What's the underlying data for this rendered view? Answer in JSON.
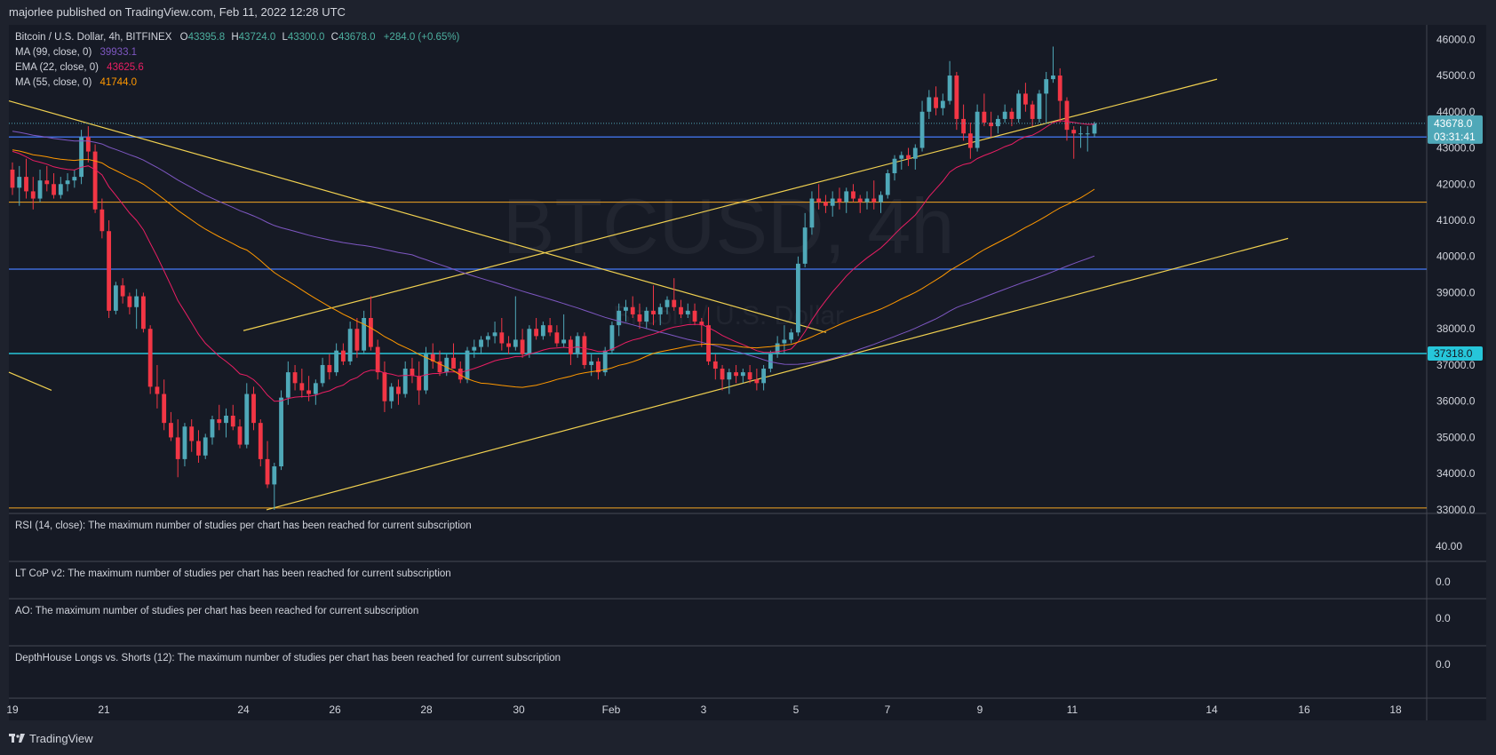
{
  "header": {
    "published": "majorlee published on TradingView.com, Feb 11, 2022 12:28 UTC"
  },
  "legend": {
    "symbol": "Bitcoin / U.S. Dollar, 4h, BITFINEX",
    "open_label": "O",
    "open": "43395.8",
    "high_label": "H",
    "high": "43724.0",
    "low_label": "L",
    "low": "43300.0",
    "close_label": "C",
    "close": "43678.0",
    "change": "+284.0 (+0.65%)",
    "indicators": [
      {
        "label": "MA (99, close, 0)",
        "value": "39933.1",
        "color": "#7e57c2"
      },
      {
        "label": "EMA (22, close, 0)",
        "value": "43625.6",
        "color": "#e91e63"
      },
      {
        "label": "MA (55, close, 0)",
        "value": "41744.0",
        "color": "#ff9800"
      }
    ]
  },
  "watermark": {
    "symbol": "BTCUSD, 4h",
    "name": "Bitcoin / U.S. Dollar"
  },
  "price_badges": {
    "last": "43678.0",
    "countdown": "03:31:41",
    "level": "37318.0"
  },
  "panes": [
    {
      "label": "RSI (14, close): The maximum number of studies per chart has been reached for current subscription",
      "value": "40.00"
    },
    {
      "label": "LT CoP v2: The maximum number of studies per chart has been reached for current subscription",
      "value": "0.0"
    },
    {
      "label": "AO: The maximum number of studies per chart has been reached for current subscription",
      "value": "0.0"
    },
    {
      "label": "DepthHouse Longs vs. Shorts (12): The maximum number of studies per chart has been reached for current subscription",
      "value": "0.0"
    }
  ],
  "footer": {
    "brand": "TradingView"
  },
  "colors": {
    "up": "#4fa8b8",
    "down": "#f23645",
    "trendline": "#f0d050",
    "support_blue": "#3d6bd6",
    "support_cyan": "#26c6da",
    "support_orange": "#f5a623"
  },
  "chart_data": {
    "type": "candlestick",
    "title": "Bitcoin / U.S. Dollar, 4h, BITFINEX",
    "x_ticks": [
      "19",
      "21",
      "24",
      "26",
      "28",
      "30",
      "Feb",
      "3",
      "5",
      "7",
      "9",
      "11",
      "14",
      "16",
      "18"
    ],
    "y_ticks": [
      33000,
      34000,
      35000,
      36000,
      37000,
      38000,
      39000,
      40000,
      41000,
      42000,
      43000,
      44000,
      45000,
      46000
    ],
    "ylim": [
      32900,
      46400
    ],
    "candles": [
      [
        42400,
        42600,
        41700,
        41900
      ],
      [
        41900,
        42500,
        41400,
        42200
      ],
      [
        42200,
        42700,
        41600,
        41800
      ],
      [
        41800,
        42200,
        41300,
        41600
      ],
      [
        41600,
        42400,
        41500,
        42100
      ],
      [
        42100,
        42500,
        41800,
        42000
      ],
      [
        42000,
        42300,
        41600,
        41700
      ],
      [
        41700,
        42200,
        41600,
        42000
      ],
      [
        42000,
        42300,
        41800,
        42100
      ],
      [
        42100,
        42400,
        41900,
        42200
      ],
      [
        42200,
        43500,
        42000,
        43300
      ],
      [
        43300,
        43600,
        42600,
        42900
      ],
      [
        42900,
        43100,
        41200,
        41300
      ],
      [
        41300,
        41600,
        40500,
        40700
      ],
      [
        40700,
        41000,
        38300,
        38500
      ],
      [
        38500,
        39300,
        38400,
        39200
      ],
      [
        39200,
        39400,
        38700,
        38900
      ],
      [
        38900,
        39000,
        38400,
        38600
      ],
      [
        38600,
        39100,
        38000,
        38900
      ],
      [
        38900,
        39000,
        37900,
        38000
      ],
      [
        38000,
        38100,
        36200,
        36400
      ],
      [
        36400,
        37000,
        35800,
        36200
      ],
      [
        36200,
        36600,
        35200,
        35400
      ],
      [
        35400,
        35700,
        34900,
        35000
      ],
      [
        35000,
        35500,
        33900,
        34400
      ],
      [
        34400,
        35400,
        34200,
        35300
      ],
      [
        35300,
        35500,
        34600,
        34900
      ],
      [
        34900,
        35200,
        34300,
        34500
      ],
      [
        34500,
        35100,
        34400,
        35000
      ],
      [
        35000,
        35600,
        34800,
        35500
      ],
      [
        35500,
        35900,
        35200,
        35400
      ],
      [
        35400,
        35800,
        35000,
        35600
      ],
      [
        35600,
        35900,
        35200,
        35300
      ],
      [
        35300,
        35500,
        34700,
        34800
      ],
      [
        34800,
        36500,
        34700,
        36200
      ],
      [
        36200,
        36400,
        35200,
        35400
      ],
      [
        35400,
        35500,
        34200,
        34400
      ],
      [
        34400,
        34900,
        33600,
        33700
      ],
      [
        33700,
        34300,
        33000,
        34200
      ],
      [
        34200,
        36300,
        34100,
        36100
      ],
      [
        36100,
        37100,
        35900,
        36800
      ],
      [
        36800,
        37000,
        36300,
        36500
      ],
      [
        36500,
        36900,
        36100,
        36300
      ],
      [
        36300,
        36700,
        36000,
        36200
      ],
      [
        36200,
        36600,
        35900,
        36500
      ],
      [
        36500,
        37200,
        36400,
        37000
      ],
      [
        37000,
        37300,
        36600,
        36800
      ],
      [
        36800,
        37600,
        36700,
        37400
      ],
      [
        37400,
        37600,
        37000,
        37100
      ],
      [
        37100,
        38200,
        37000,
        38000
      ],
      [
        38000,
        38300,
        37200,
        37400
      ],
      [
        37400,
        38500,
        37300,
        38300
      ],
      [
        38300,
        38900,
        37400,
        37500
      ],
      [
        37500,
        37700,
        36600,
        36800
      ],
      [
        36800,
        37100,
        35700,
        36000
      ],
      [
        36000,
        36500,
        35800,
        36400
      ],
      [
        36400,
        36600,
        35900,
        36200
      ],
      [
        36200,
        37100,
        36100,
        36900
      ],
      [
        36900,
        37200,
        36500,
        36700
      ],
      [
        36700,
        37100,
        35900,
        36300
      ],
      [
        36300,
        37500,
        36200,
        37300
      ],
      [
        37300,
        37600,
        36900,
        37100
      ],
      [
        37100,
        37400,
        36700,
        36800
      ],
      [
        36800,
        37300,
        36700,
        37200
      ],
      [
        37200,
        37600,
        36900,
        36900
      ],
      [
        36900,
        37100,
        36500,
        36600
      ],
      [
        36600,
        37500,
        36500,
        37400
      ],
      [
        37400,
        37700,
        37200,
        37500
      ],
      [
        37500,
        37800,
        37300,
        37700
      ],
      [
        37700,
        37900,
        37500,
        37800
      ],
      [
        37800,
        38200,
        37600,
        37900
      ],
      [
        37900,
        38300,
        37400,
        37600
      ],
      [
        37600,
        37800,
        37300,
        37500
      ],
      [
        37500,
        38900,
        37400,
        37700
      ],
      [
        37700,
        38000,
        37200,
        37300
      ],
      [
        37300,
        38100,
        37200,
        38000
      ],
      [
        38000,
        38300,
        37700,
        37800
      ],
      [
        37800,
        38200,
        37700,
        38100
      ],
      [
        38100,
        38300,
        37800,
        37900
      ],
      [
        37900,
        38100,
        37500,
        37600
      ],
      [
        37600,
        38400,
        37500,
        37700
      ],
      [
        37700,
        37800,
        37000,
        37300
      ],
      [
        37300,
        37900,
        37200,
        37800
      ],
      [
        37800,
        37900,
        36900,
        37000
      ],
      [
        37000,
        37300,
        36700,
        37100
      ],
      [
        37100,
        37200,
        36600,
        36800
      ],
      [
        36800,
        37500,
        36700,
        37400
      ],
      [
        37400,
        38200,
        37300,
        38100
      ],
      [
        38100,
        38700,
        37800,
        38500
      ],
      [
        38500,
        38800,
        38200,
        38600
      ],
      [
        38600,
        38900,
        38300,
        38400
      ],
      [
        38400,
        38700,
        38000,
        38200
      ],
      [
        38200,
        38600,
        38000,
        38500
      ],
      [
        38500,
        39200,
        38100,
        38400
      ],
      [
        38400,
        38700,
        38100,
        38600
      ],
      [
        38600,
        38900,
        38400,
        38800
      ],
      [
        38800,
        39400,
        38500,
        38600
      ],
      [
        38600,
        38800,
        38300,
        38400
      ],
      [
        38400,
        38700,
        38300,
        38500
      ],
      [
        38500,
        38700,
        38100,
        38200
      ],
      [
        38200,
        38300,
        37500,
        38100
      ],
      [
        38100,
        38600,
        37000,
        37100
      ],
      [
        37100,
        37300,
        36600,
        36900
      ],
      [
        36900,
        37000,
        36300,
        36600
      ],
      [
        36600,
        36900,
        36200,
        36800
      ],
      [
        36800,
        37000,
        36500,
        36700
      ],
      [
        36700,
        36900,
        36500,
        36800
      ],
      [
        36800,
        37000,
        36500,
        36600
      ],
      [
        36600,
        36900,
        36300,
        36500
      ],
      [
        36500,
        37000,
        36300,
        36900
      ],
      [
        36900,
        37400,
        36800,
        37300
      ],
      [
        37300,
        37800,
        37200,
        37600
      ],
      [
        37600,
        38100,
        37300,
        37700
      ],
      [
        37700,
        38000,
        37600,
        37900
      ],
      [
        37900,
        40000,
        37800,
        39800
      ],
      [
        39800,
        41200,
        39700,
        40800
      ],
      [
        40800,
        41800,
        40600,
        41600
      ],
      [
        41600,
        42000,
        41300,
        41500
      ],
      [
        41500,
        41700,
        41200,
        41400
      ],
      [
        41400,
        41800,
        41100,
        41600
      ],
      [
        41600,
        41900,
        41300,
        41500
      ],
      [
        41500,
        41900,
        41200,
        41800
      ],
      [
        41800,
        42000,
        41500,
        41600
      ],
      [
        41600,
        41700,
        41200,
        41500
      ],
      [
        41500,
        41800,
        41300,
        41600
      ],
      [
        41600,
        42100,
        41300,
        41500
      ],
      [
        41500,
        41800,
        41200,
        41700
      ],
      [
        41700,
        42400,
        41600,
        42300
      ],
      [
        42300,
        42800,
        42100,
        42700
      ],
      [
        42700,
        42900,
        42400,
        42800
      ],
      [
        42800,
        43000,
        42500,
        42700
      ],
      [
        42700,
        43100,
        42400,
        43000
      ],
      [
        43000,
        44300,
        42900,
        44000
      ],
      [
        44000,
        44600,
        43800,
        44400
      ],
      [
        44400,
        44700,
        43900,
        44100
      ],
      [
        44100,
        44500,
        43900,
        44300
      ],
      [
        44300,
        45400,
        44200,
        45000
      ],
      [
        45000,
        45100,
        43500,
        43800
      ],
      [
        43800,
        44200,
        43200,
        43400
      ],
      [
        43400,
        43700,
        42700,
        43000
      ],
      [
        43000,
        44200,
        42900,
        44000
      ],
      [
        44000,
        44500,
        43600,
        43700
      ],
      [
        43700,
        44000,
        43300,
        43600
      ],
      [
        43600,
        43900,
        43400,
        43800
      ],
      [
        43800,
        44200,
        43700,
        44000
      ],
      [
        44000,
        44100,
        43600,
        43800
      ],
      [
        43800,
        44600,
        43700,
        44500
      ],
      [
        44500,
        44800,
        44000,
        44200
      ],
      [
        44200,
        44300,
        43600,
        43800
      ],
      [
        43800,
        44600,
        43700,
        44500
      ],
      [
        44500,
        45100,
        43700,
        44900
      ],
      [
        44900,
        45800,
        44800,
        45000
      ],
      [
        45000,
        45200,
        43700,
        44300
      ],
      [
        44300,
        44400,
        43200,
        43500
      ],
      [
        43500,
        43600,
        42700,
        43400
      ],
      [
        43400,
        43600,
        43000,
        43400
      ],
      [
        43400,
        43600,
        42900,
        43400
      ],
      [
        43395.8,
        43724,
        43300,
        43678
      ]
    ],
    "horizontal_levels": [
      {
        "price": 43300,
        "color": "#3d6bd6"
      },
      {
        "price": 41500,
        "color": "#f5a623"
      },
      {
        "price": 39650,
        "color": "#3d6bd6"
      },
      {
        "price": 37318,
        "color": "#26c6da"
      },
      {
        "price": 33050,
        "color": "#f5a623"
      }
    ]
  }
}
